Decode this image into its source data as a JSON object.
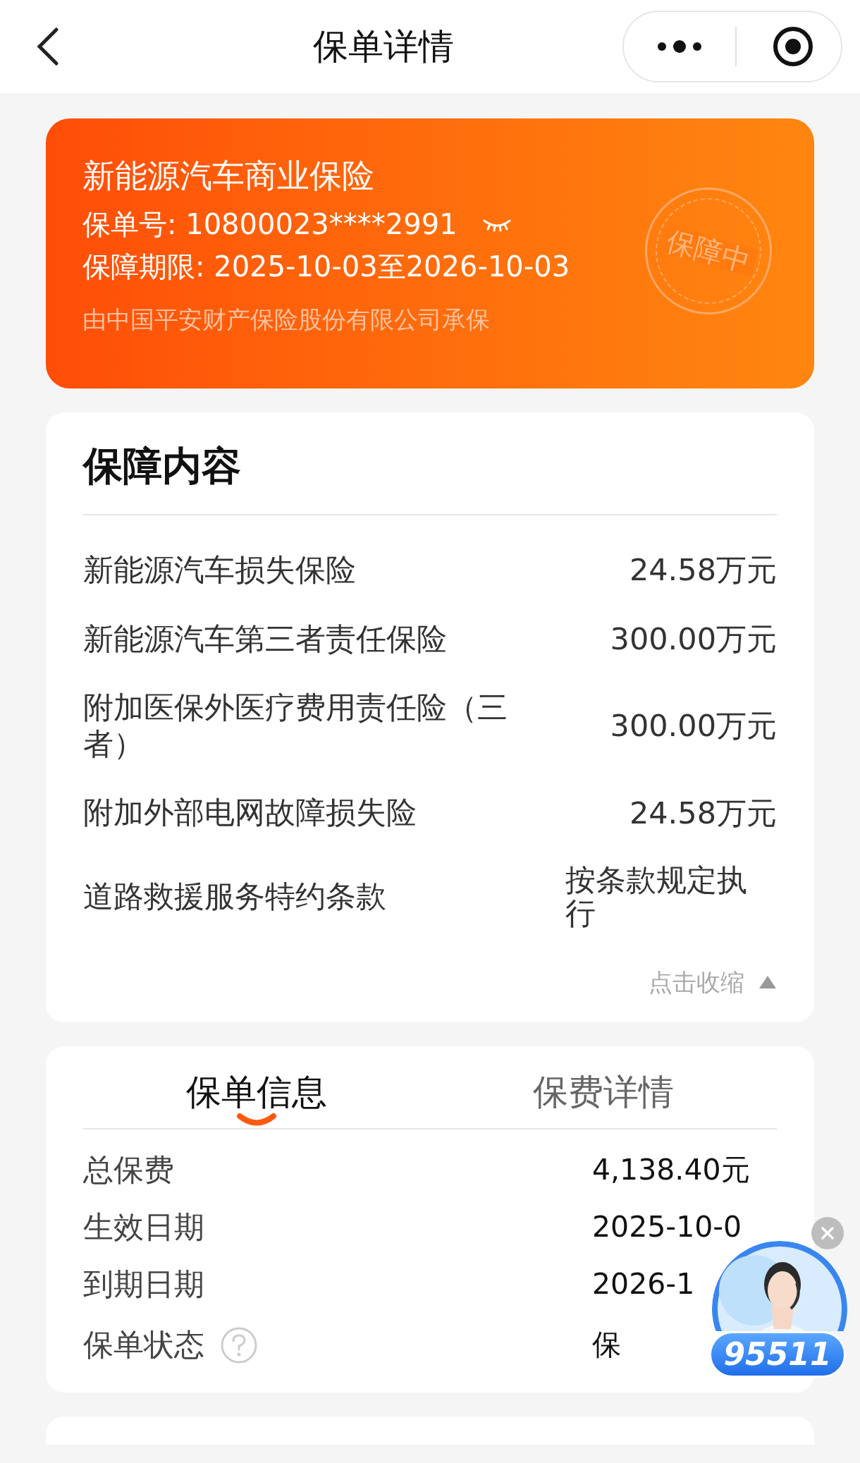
{
  "nav": {
    "title": "保单详情"
  },
  "policy": {
    "name": "新能源汽车商业保险",
    "number_label": "保单号: ",
    "number": "10800023****2991",
    "number_hidden": true,
    "period_label": "保障期限: ",
    "period": "2025-10-03至2026-10-03",
    "insurer": "由中国平安财产保险股份有限公司承保",
    "stamp": "保障中"
  },
  "coverage": {
    "title": "保障内容",
    "expanded": true,
    "collapse": "点击收缩",
    "items": [
      {
        "label": "新能源汽车损失保险",
        "value": "24.58万元"
      },
      {
        "label": "新能源汽车第三者责任保险",
        "value": "300.00万元"
      },
      {
        "label": "附加医保外医疗费用责任险（三者）",
        "value": "300.00万元"
      },
      {
        "label": "附加外部电网故障损失险",
        "value": "24.58万元"
      },
      {
        "label": "道路救援服务特约条款",
        "value": "按条款规定执行"
      }
    ]
  },
  "info": {
    "tabs": [
      {
        "label": "保单信息",
        "selected": true
      },
      {
        "label": "保费详情",
        "selected": false
      }
    ],
    "rows": [
      {
        "label": "总保费",
        "value": "4,138.40元",
        "help": false
      },
      {
        "label": "生效日期",
        "value": "2025-10-0",
        "help": false
      },
      {
        "label": "到期日期",
        "value": "2026-1",
        "help": false
      },
      {
        "label": "保单状态",
        "value": "保",
        "help": true
      }
    ]
  },
  "service": {
    "phone": "95511"
  }
}
